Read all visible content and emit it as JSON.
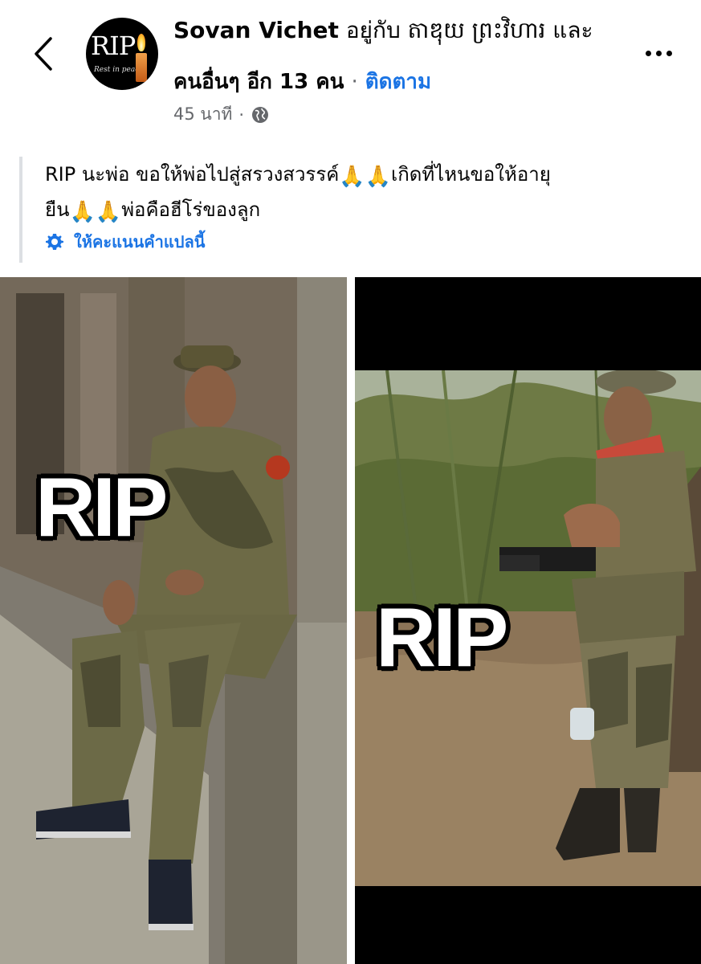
{
  "header": {
    "back_icon": "chevron-left-icon",
    "avatar": {
      "text": "RIP",
      "subtext": "Rest in peace"
    },
    "author": "Sovan Vichet",
    "with_text": "อยู่กับ តាឌុយ ព្រះវិហារ และ",
    "others_text": "คนอื่นๆ อีก 13 คน",
    "separator": "·",
    "follow_label": "ติดตาม",
    "timestamp": "45 นาที",
    "meta_separator": "·",
    "privacy_icon": "globe-icon",
    "more_icon": "more-horizontal-icon"
  },
  "post": {
    "line1_a": "RIP นะพ่อ ขอให้พ่อไปสู่สรวงสวรรค์",
    "emoji": "🙏",
    "line1_b": "เกิดที่ไหนขอให้อายุ",
    "line2_a": "ยืน",
    "line2_b": "พ่อคือฮีโร่ของลูก",
    "translate_icon": "gear-icon",
    "translate_label": "ให้คะแนนคำแปลนี้"
  },
  "photos": [
    {
      "overlay_text": "RIP"
    },
    {
      "overlay_text": "RIP"
    }
  ],
  "colors": {
    "link": "#1b74e4",
    "meta": "#65676b",
    "text": "#050505"
  }
}
